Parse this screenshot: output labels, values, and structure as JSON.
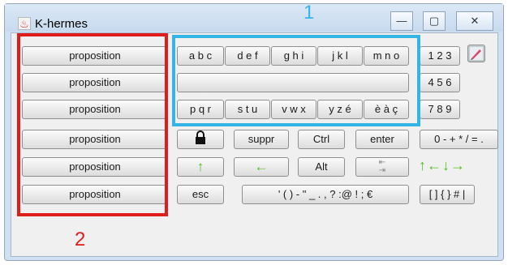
{
  "window": {
    "title": "K-hermes",
    "controls": {
      "minimize": "—",
      "maximize": "▢",
      "close": "✕"
    }
  },
  "propositions": [
    "proposition",
    "proposition",
    "proposition",
    "proposition",
    "proposition",
    "proposition"
  ],
  "letter_groups": {
    "row1": [
      "a b c",
      "d e f",
      "g h i",
      "j k l",
      "m n o"
    ],
    "row3": [
      "p q r",
      "s t u",
      "v w x",
      "y z é",
      "è à ç"
    ]
  },
  "numbers": {
    "row1": "1 2 3",
    "row2": "4 5 6",
    "row3": "7 8 9"
  },
  "keys": {
    "suppr": "suppr",
    "ctrl": "Ctrl",
    "enter": "enter",
    "operators": "0 - + * / = .",
    "alt": "Alt",
    "esc": "esc",
    "punctuation": "' ( ) - \" _ . , ? :@ ! ; €",
    "brackets": "[ ] { } # |"
  },
  "annotations": {
    "label1": "1",
    "label2": "2",
    "box1_color": "#35b5e5",
    "box2_color": "#e01d1d"
  },
  "icons": {
    "app": "java-cup-icon",
    "lock": "lock-icon",
    "shift": "green-up-arrow-icon",
    "backspace": "green-left-arrow-icon",
    "tab": "tab-icon",
    "close_keyboard": "pencil-icon",
    "arrows": "green-arrow-keys-icon"
  }
}
